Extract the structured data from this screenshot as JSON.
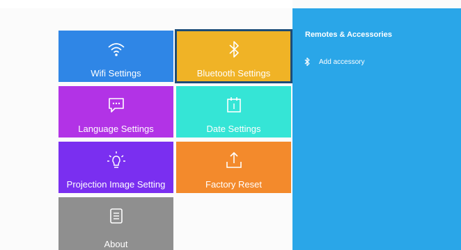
{
  "tiles": {
    "wifi": {
      "label": "Wifi Settings",
      "icon": "wifi-icon",
      "color": "#2f86e6"
    },
    "bluetooth": {
      "label": "Bluetooth Settings",
      "icon": "bluetooth-icon",
      "color": "#f0b326"
    },
    "language": {
      "label": "Language Settings",
      "icon": "chat-bubble-icon",
      "color": "#b233e6"
    },
    "date": {
      "label": "Date Settings",
      "icon": "calendar-icon",
      "color": "#35e5d6"
    },
    "projection": {
      "label": "Projection Image Setting",
      "icon": "lightbulb-icon",
      "color": "#7a2ff0"
    },
    "reset": {
      "label": "Factory Reset",
      "icon": "upload-tray-icon",
      "color": "#f38a2c"
    },
    "about": {
      "label": "About",
      "icon": "document-icon",
      "color": "#8f8f8f"
    }
  },
  "panel": {
    "title": "Remotes & Accessories",
    "items": [
      {
        "label": "Add accessory",
        "icon": "bluetooth-icon"
      }
    ],
    "color": "#2aa6e8"
  }
}
